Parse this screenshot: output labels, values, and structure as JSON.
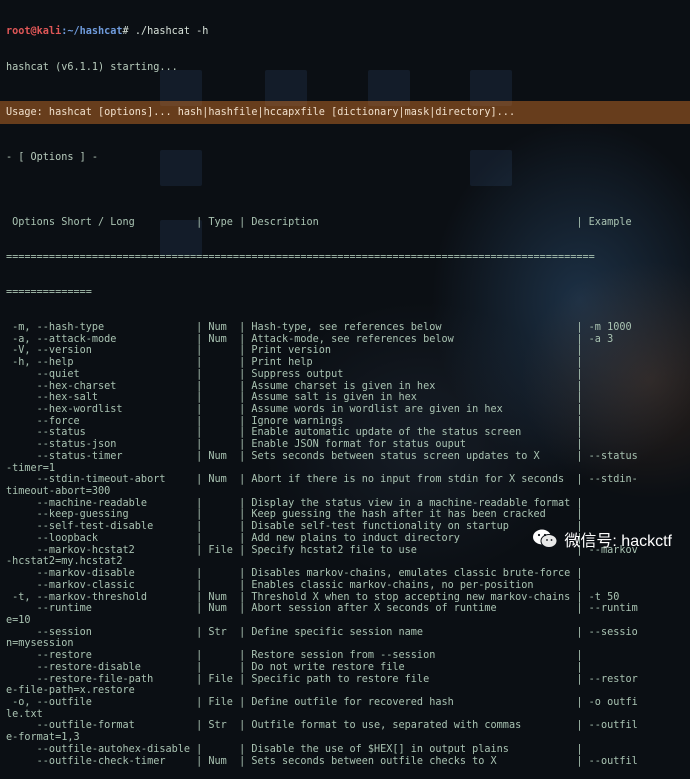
{
  "prompt": {
    "user_host": "root@kali",
    "path": ":~/hashcat",
    "symbol": "#",
    "command": " ./hashcat -h"
  },
  "starting": "hashcat (v6.1.1) starting...",
  "usage": "Usage: hashcat [options]... hash|hashfile|hccapxfile [dictionary|mask|directory]...",
  "options_heading": "- [ Options ] -",
  "table_header": " Options Short / Long          | Type | Description                                          | Example",
  "separator": "================================================================================================",
  "separator_tail": "==============",
  "lines": [
    " -m, --hash-type               | Num  | Hash-type, see references below                      | -m 1000",
    " -a, --attack-mode             | Num  | Attack-mode, see references below                    | -a 3",
    " -V, --version                 |      | Print version                                        |",
    " -h, --help                    |      | Print help                                           |",
    "     --quiet                   |      | Suppress output                                      |",
    "     --hex-charset             |      | Assume charset is given in hex                       |",
    "     --hex-salt                |      | Assume salt is given in hex                          |",
    "     --hex-wordlist            |      | Assume words in wordlist are given in hex            |",
    "     --force                   |      | Ignore warnings                                      |",
    "     --status                  |      | Enable automatic update of the status screen         |",
    "     --status-json             |      | Enable JSON format for status ouput                  |",
    "     --status-timer            | Num  | Sets seconds between status screen updates to X      | --status",
    "-timer=1",
    "     --stdin-timeout-abort     | Num  | Abort if there is no input from stdin for X seconds  | --stdin-",
    "timeout-abort=300",
    "     --machine-readable        |      | Display the status view in a machine-readable format |",
    "     --keep-guessing           |      | Keep guessing the hash after it has been cracked     |",
    "     --self-test-disable       |      | Disable self-test functionality on startup           |",
    "     --loopback                |      | Add new plains to induct directory                   |",
    "     --markov-hcstat2          | File | Specify hcstat2 file to use                          | --markov",
    "-hcstat2=my.hcstat2",
    "     --markov-disable          |      | Disables markov-chains, emulates classic brute-force |",
    "     --markov-classic          |      | Enables classic markov-chains, no per-position       |",
    " -t, --markov-threshold        | Num  | Threshold X when to stop accepting new markov-chains | -t 50",
    "     --runtime                 | Num  | Abort session after X seconds of runtime             | --runtim",
    "e=10",
    "     --session                 | Str  | Define specific session name                         | --sessio",
    "n=mysession",
    "     --restore                 |      | Restore session from --session                       |",
    "     --restore-disable         |      | Do not write restore file                            |",
    "     --restore-file-path       | File | Specific path to restore file                        | --restor",
    "e-file-path=x.restore",
    " -o, --outfile                 | File | Define outfile for recovered hash                    | -o outfi",
    "le.txt",
    "     --outfile-format          | Str  | Outfile format to use, separated with commas         | --outfil",
    "e-format=1,3",
    "     --outfile-autohex-disable |      | Disable the use of $HEX[] in output plains           |",
    "     --outfile-check-timer     | Num  | Sets seconds between outfile checks to X             | --outfil"
  ],
  "watermark": {
    "icon": "wechat-icon",
    "text": "微信号: hackctf"
  },
  "colors": {
    "prompt_user": "#e05757",
    "prompt_path": "#6f9bdc",
    "usage_bar": "#e87e28",
    "text": "#b8ccbd"
  }
}
